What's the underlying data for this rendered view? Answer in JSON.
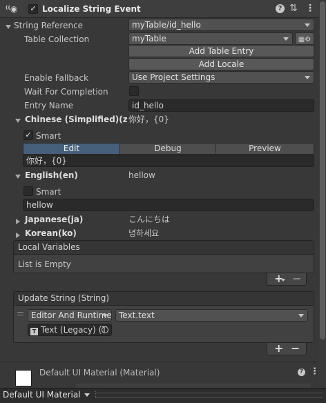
{
  "header": {
    "title": "Localize String Event",
    "enabled": true
  },
  "string_reference": {
    "label": "String Reference",
    "value": "myTable/id_hello"
  },
  "table_collection": {
    "label": "Table Collection",
    "value": "myTable"
  },
  "buttons": {
    "add_table_entry": "Add Table Entry",
    "add_locale": "Add Locale"
  },
  "enable_fallback": {
    "label": "Enable Fallback",
    "value": "Use Project Settings"
  },
  "wait_for_completion": {
    "label": "Wait For Completion",
    "checked": false
  },
  "entry_name": {
    "label": "Entry Name",
    "value": "id_hello"
  },
  "locales": [
    {
      "name": "Chinese (Simplified)(zl",
      "preview": "你好，{0}",
      "expanded": true,
      "smart_label": "Smart",
      "smart": true,
      "text": "你好，{0}"
    },
    {
      "name": "English(en)",
      "preview": "hellow",
      "expanded": true,
      "smart_label": "Smart",
      "smart": false,
      "text": "hellow"
    },
    {
      "name": "Japanese(ja)",
      "preview": "こんにちは",
      "expanded": false
    },
    {
      "name": "Korean(ko)",
      "preview": "녕하세요",
      "expanded": false
    }
  ],
  "tabs": [
    "Edit",
    "Debug",
    "Preview"
  ],
  "local_variables": {
    "title": "Local Variables",
    "empty_text": "List is Empty"
  },
  "update_string": {
    "title": "Update String (String)",
    "runtime": "Editor And Runtime",
    "function": "Text.text",
    "target": "Text (Legacy) (T"
  },
  "material": {
    "title": "Default UI Material (Material)"
  },
  "footer": {
    "label": "Default UI Material"
  }
}
